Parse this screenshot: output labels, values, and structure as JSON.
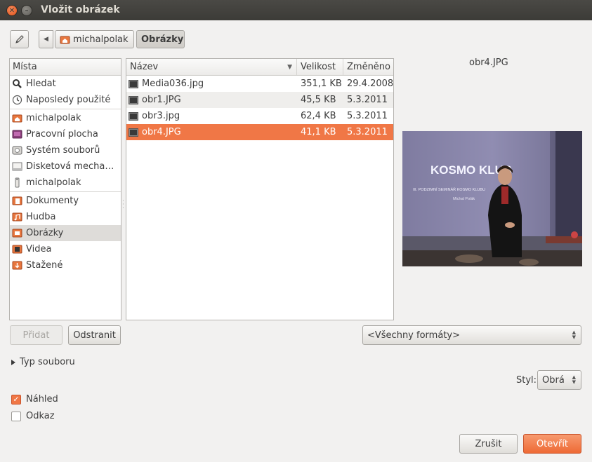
{
  "window": {
    "title": "Vložit obrázek"
  },
  "toolbar": {
    "path": [
      "michalpolak",
      "Obrázky"
    ]
  },
  "places": {
    "header": "Místa",
    "items": [
      {
        "label": "Hledat",
        "icon": "search-icon"
      },
      {
        "label": "Naposledy použité",
        "icon": "recent-icon"
      },
      {
        "label": "michalpolak",
        "icon": "home-folder-icon"
      },
      {
        "label": "Pracovní plocha",
        "icon": "desktop-icon"
      },
      {
        "label": "Systém souborů",
        "icon": "harddisk-icon"
      },
      {
        "label": "Disketová mecha…",
        "icon": "floppy-icon"
      },
      {
        "label": "michalpolak",
        "icon": "usb-drive-icon"
      },
      {
        "label": "Dokumenty",
        "icon": "documents-folder-icon"
      },
      {
        "label": "Hudba",
        "icon": "music-folder-icon"
      },
      {
        "label": "Obrázky",
        "icon": "pictures-folder-icon"
      },
      {
        "label": "Videa",
        "icon": "videos-folder-icon"
      },
      {
        "label": "Stažené",
        "icon": "downloads-folder-icon"
      }
    ],
    "selected": "Obrázky"
  },
  "files": {
    "columns": [
      "Název",
      "Velikost",
      "Změněno"
    ],
    "rows": [
      {
        "name": "Media036.jpg",
        "size": "351,1 KB",
        "modified": "29.4.2008"
      },
      {
        "name": "obr1.JPG",
        "size": "45,5 KB",
        "modified": "5.3.2011"
      },
      {
        "name": "obr3.jpg",
        "size": "62,4 KB",
        "modified": "5.3.2011"
      },
      {
        "name": "obr4.JPG",
        "size": "41,1 KB",
        "modified": "5.3.2011"
      }
    ],
    "selected": "obr4.JPG"
  },
  "preview": {
    "filename": "obr4.JPG",
    "slide_title": "KOSMO KLUB",
    "slide_subtitle": "III. PODZIMNÍ SEMINÁŘ KOSMO KLUBU",
    "slide_author": "Michal Polák"
  },
  "buttons": {
    "add": "Přidat",
    "remove": "Odstranit",
    "cancel": "Zrušit",
    "open": "Otevřít"
  },
  "filter": {
    "value": "<Všechny formáty>"
  },
  "file_type_expander": "Typ souboru",
  "style": {
    "label": "Styl:",
    "value": "Obrá"
  },
  "options": {
    "preview_label": "Náhled",
    "preview_checked": true,
    "link_label": "Odkaz",
    "link_checked": false
  },
  "colors": {
    "accent": "#f07746",
    "titlebar": "#3c3b37"
  }
}
